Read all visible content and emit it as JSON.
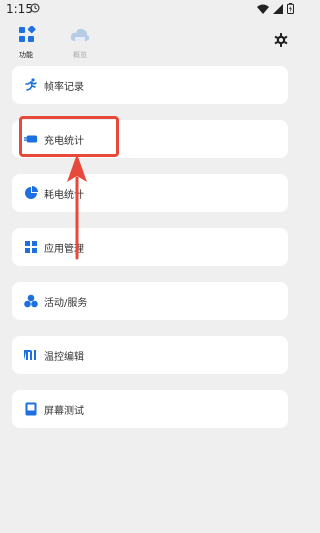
{
  "status_bar": {
    "time": "1:15",
    "icons": [
      "clock-icon",
      "wifi-icon",
      "signal-icon",
      "battery-icon"
    ]
  },
  "tabs": [
    {
      "label": "功能",
      "icon": "apps-icon",
      "active": true
    },
    {
      "label": "概览",
      "icon": "cloud-icon",
      "active": false
    }
  ],
  "settings_icon": "gear-icon",
  "menu": [
    {
      "label": "帧率记录",
      "icon": "running-icon"
    },
    {
      "label": "充电统计",
      "icon": "charging-icon"
    },
    {
      "label": "耗电统计",
      "icon": "pie-icon"
    },
    {
      "label": "应用管理",
      "icon": "grid-icon"
    },
    {
      "label": "活动/服务",
      "icon": "activity-icon"
    },
    {
      "label": "温控编辑",
      "icon": "mi-icon"
    },
    {
      "label": "屏幕测试",
      "icon": "screen-icon"
    }
  ],
  "colors": {
    "accent": "#1e6fe0",
    "highlight": "#e74a3b",
    "background": "#efefef"
  }
}
